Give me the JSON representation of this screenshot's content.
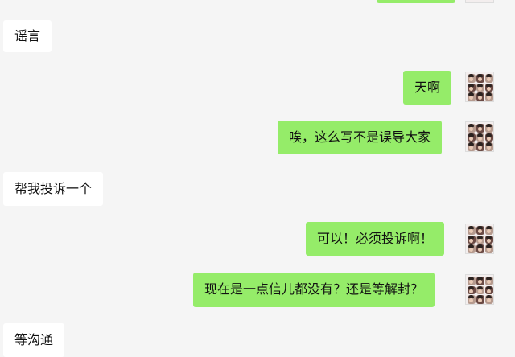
{
  "chat": {
    "messages": [
      {
        "from": "other",
        "text": "谣言"
      },
      {
        "from": "me",
        "text": "天啊"
      },
      {
        "from": "me",
        "text": "唉，这么写不是误导大家"
      },
      {
        "from": "other",
        "text": "帮我投诉一个"
      },
      {
        "from": "me",
        "text": "可以！必须投诉啊！"
      },
      {
        "from": "me",
        "text": "现在是一点信儿都没有？还是等解封？"
      },
      {
        "from": "other",
        "text": "等沟通"
      }
    ]
  },
  "colors": {
    "background": "#f5f5f5",
    "incoming_bubble": "#ffffff",
    "outgoing_bubble": "#95ec69"
  },
  "icons": {
    "avatar": "user-avatar-photo-grid"
  }
}
